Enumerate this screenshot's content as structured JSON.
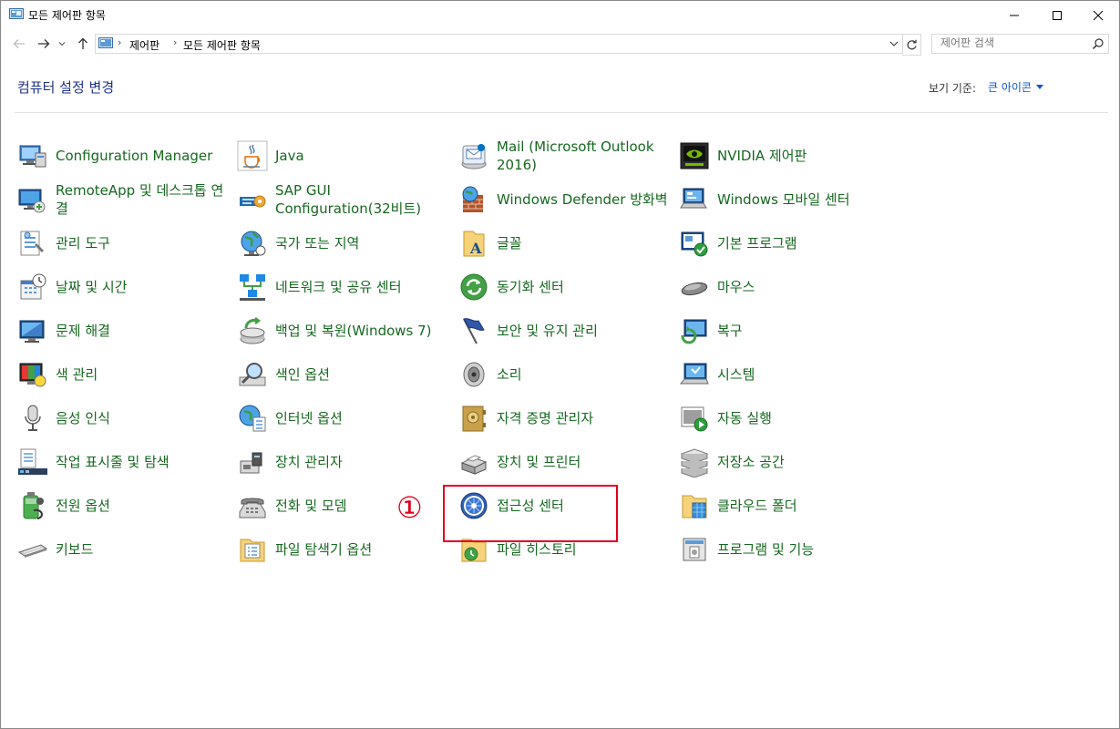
{
  "window": {
    "title": "모든 제어판 항목"
  },
  "nav": {
    "breadcrumbs": [
      "제어판",
      "모든 제어판 항목"
    ],
    "search_placeholder": "제어판 검색"
  },
  "header": {
    "title": "컴퓨터 설정 변경",
    "view_by_label": "보기 기준:",
    "view_by_value": "큰 아이콘"
  },
  "items": [
    [
      "Configuration Manager",
      "RemoteApp 및 데스크톱 연결",
      "관리 도구",
      "날짜 및 시간",
      "문제 해결",
      "색 관리",
      "음성 인식",
      "작업 표시줄 및 탐색",
      "전원 옵션",
      "키보드"
    ],
    [
      "Java",
      "SAP GUI Configuration(32비트)",
      "국가 또는 지역",
      "네트워크 및 공유 센터",
      "백업 및 복원(Windows 7)",
      "색인 옵션",
      "인터넷 옵션",
      "장치 관리자",
      "전화 및 모뎀",
      "파일 탐색기 옵션"
    ],
    [
      "Mail (Microsoft Outlook 2016)",
      "Windows Defender 방화벽",
      "글꼴",
      "동기화 센터",
      "보안 및 유지 관리",
      "소리",
      "자격 증명 관리자",
      "장치 및 프린터",
      "접근성 센터",
      "파일 히스토리"
    ],
    [
      "NVIDIA 제어판",
      "Windows 모바일 센터",
      "기본 프로그램",
      "마우스",
      "복구",
      "시스템",
      "자동 실행",
      "저장소 공간",
      "클라우드 폴더",
      "프로그램 및 기능"
    ]
  ],
  "annotation": {
    "marker": "①"
  },
  "colors": {
    "link": "#16681f",
    "heading": "#1e3287",
    "highlight": "#e2001a"
  }
}
